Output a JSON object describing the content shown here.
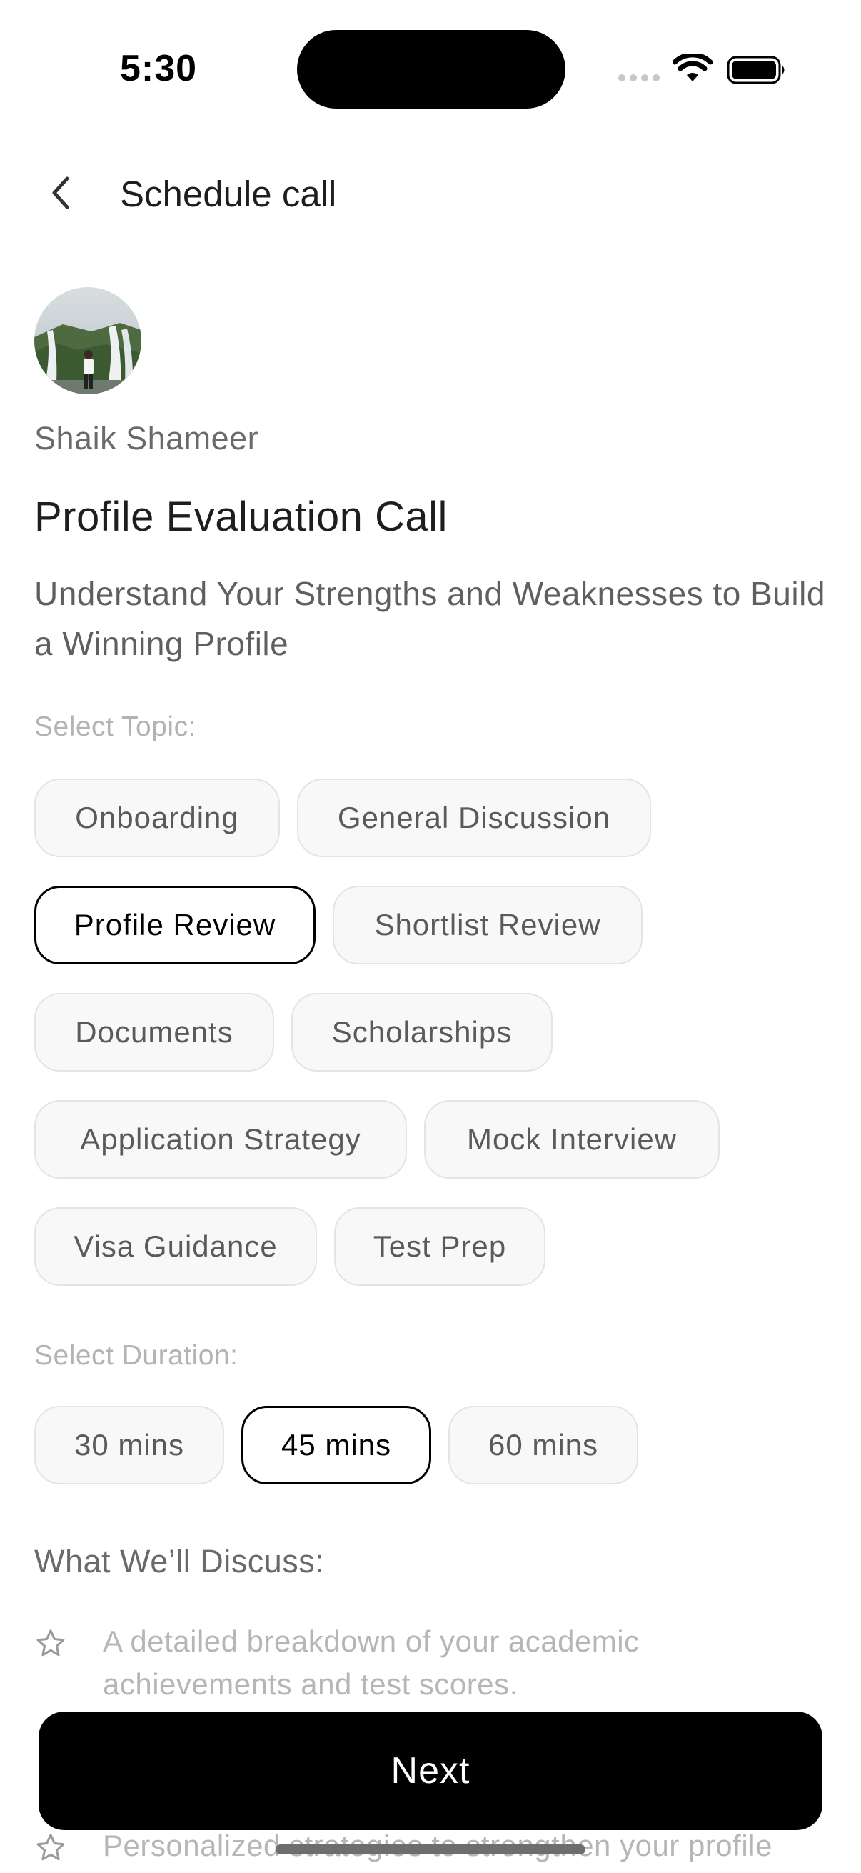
{
  "status_bar": {
    "time": "5:30"
  },
  "header": {
    "title": "Schedule call"
  },
  "advisor": {
    "name": "Shaik Shameer"
  },
  "call": {
    "title": "Profile Evaluation Call",
    "subtitle": "Understand Your Strengths and Weaknesses to Build a Winning Profile"
  },
  "topics": {
    "label": "Select Topic:",
    "selected": "Profile Review",
    "items": [
      "Onboarding",
      "General Discussion",
      "Profile Review",
      "Shortlist Review",
      "Documents",
      "Scholarships",
      "Application Strategy",
      "Mock Interview",
      "Visa Guidance",
      "Test Prep"
    ]
  },
  "durations": {
    "label": "Select Duration:",
    "selected": "45 mins",
    "items": [
      "30 mins",
      "45 mins",
      "60 mins"
    ]
  },
  "discuss": {
    "title": "What We’ll Discuss:",
    "items": [
      "A detailed breakdown of your academic achievements and test scores.",
      "Personalized strategies to strengthen your profile"
    ]
  },
  "footer": {
    "next_label": "Next"
  },
  "colors": {
    "primary": "#000000",
    "chip_bg": "#f8f8f8",
    "chip_border": "#e4e4e4",
    "muted_text": "#b3b3b3"
  }
}
